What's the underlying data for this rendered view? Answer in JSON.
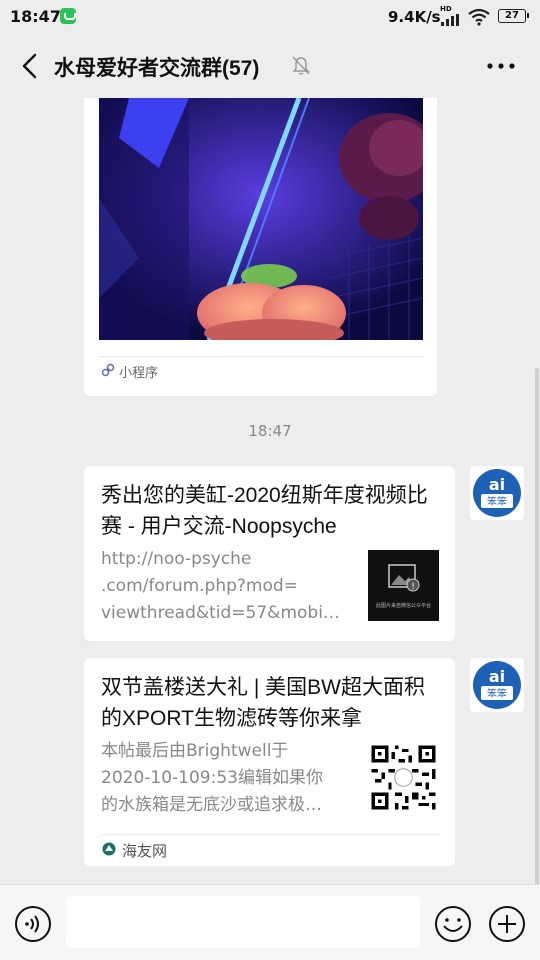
{
  "status_bar": {
    "time": "18:47",
    "app_icon": "wechat-status-icon",
    "net_speed": "9.4K/s",
    "hd_label": "HD",
    "battery": "27"
  },
  "header": {
    "back_icon": "chevron-left-icon",
    "title": "水母爱好者交流群(57)",
    "mute_icon": "bell-off-icon",
    "more_icon": "ellipsis-icon"
  },
  "messages": {
    "mini_program": {
      "tag_label": "小程序",
      "tag_icon": "mini-program-icon"
    },
    "time_divider": "18:47",
    "link1": {
      "title": "秀出您的美缸-2020纽斯年度视频比赛 - 用户交流-Noopsyche",
      "desc_lines": [
        "http://noo-psyche",
        ".com/forum.php?mod=",
        "viewthread&tid=57&mobi…"
      ],
      "thumb_caption": "此图片来自微信公众平台"
    },
    "link2": {
      "title": "双节盖楼送大礼 | 美国BW超大面积的XPORT生物滤砖等你来拿",
      "desc_lines": [
        "本帖最后由Brightwell于",
        "2020-10-109:53编辑如果你",
        "的水族箱是无底沙或追求极…"
      ],
      "source": "海友网",
      "source_icon": "haiyou-logo-icon"
    }
  },
  "input_bar": {
    "voice_icon": "voice-icon",
    "emoji_icon": "emoji-icon",
    "plus_icon": "plus-icon",
    "placeholder": ""
  },
  "colors": {
    "background": "#ededed",
    "card": "#ffffff",
    "muted_text": "#888888",
    "avatar_blue": "#1e62b8"
  }
}
